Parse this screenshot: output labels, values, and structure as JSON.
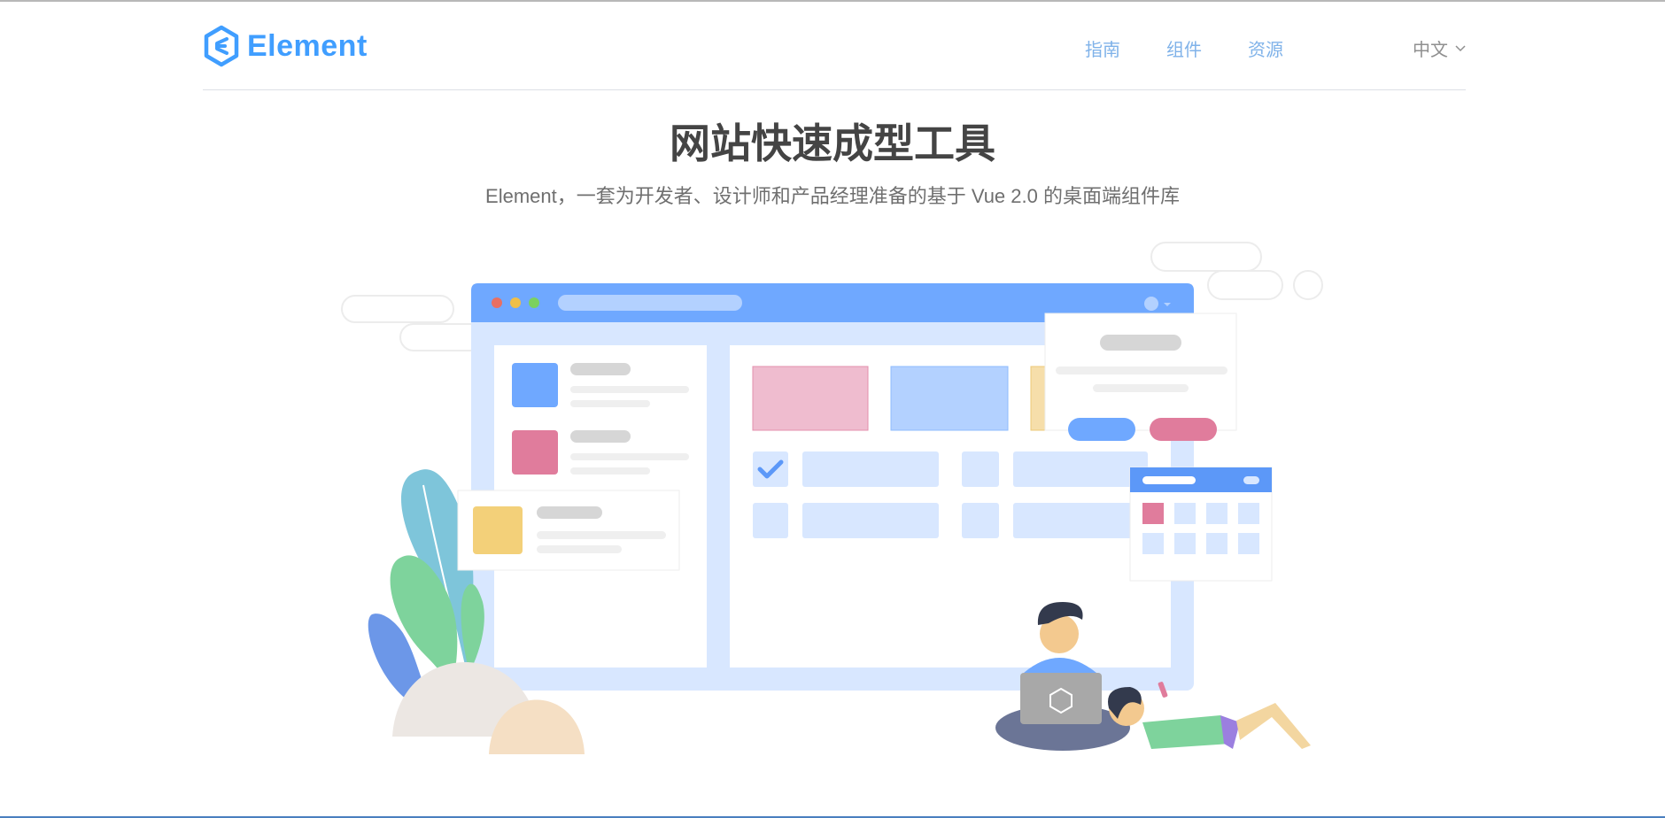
{
  "logo": {
    "text": "Element",
    "icon": "element-hexagon-logo"
  },
  "nav": {
    "items": [
      {
        "label": "指南"
      },
      {
        "label": "组件"
      },
      {
        "label": "资源"
      }
    ],
    "language": {
      "label": "中文",
      "icon": "chevron-down-icon"
    }
  },
  "hero": {
    "title": "网站快速成型工具",
    "subtitle": "Element，一套为开发者、设计师和产品经理准备的基于 Vue 2.0 的桌面端组件库"
  },
  "colors": {
    "brand": "#409eff",
    "nav_text": "#7fb2e9",
    "title": "#444444",
    "subtitle": "#6f6f6f"
  }
}
